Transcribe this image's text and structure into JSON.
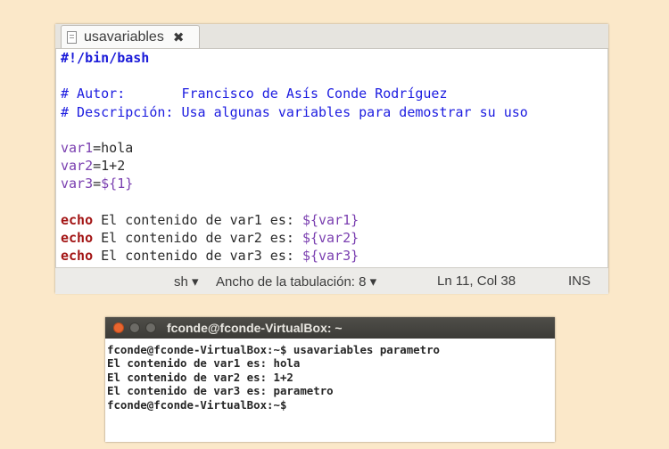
{
  "editor": {
    "tab_title": "usavariables",
    "close_glyph": "✖",
    "lines": {
      "shebang": "#!/bin/bash",
      "author_label": "# Autor:       ",
      "author_value": "Francisco de Asís Conde Rodríguez",
      "desc_label": "# Descripción: ",
      "desc_value": "Usa algunas variables para demostrar su uso",
      "var1_name": "var1",
      "var1_value": "=hola",
      "var2_name": "var2",
      "var2_value": "=1+2",
      "var3_name": "var3",
      "var3_eq": "=",
      "var3_value": "${1}",
      "echo_kw": "echo",
      "echo1_text": " El contenido de var1 es: ",
      "echo1_ref": "${var1}",
      "echo2_text": " El contenido de var2 es: ",
      "echo2_ref": "${var2}",
      "echo3_text": " El contenido de var3 es: ",
      "echo3_ref": "${var3}"
    },
    "status": {
      "language": "sh ▾",
      "tab_width": "Ancho de la tabulación: 8 ▾",
      "position": "Ln 11, Col 38",
      "mode": "INS"
    }
  },
  "terminal": {
    "title": "fconde@fconde-VirtualBox: ~",
    "lines": [
      "fconde@fconde-VirtualBox:~$ usavariables parametro",
      "El contenido de var1 es: hola",
      "El contenido de var2 es: 1+2",
      "El contenido de var3 es: parametro",
      "fconde@fconde-VirtualBox:~$"
    ]
  },
  "colors": {
    "background": "#fbe8c9",
    "comment": "#1c1ce0",
    "variable": "#7a3fb0",
    "keyword": "#a31515",
    "terminal_close": "#e8652f"
  }
}
